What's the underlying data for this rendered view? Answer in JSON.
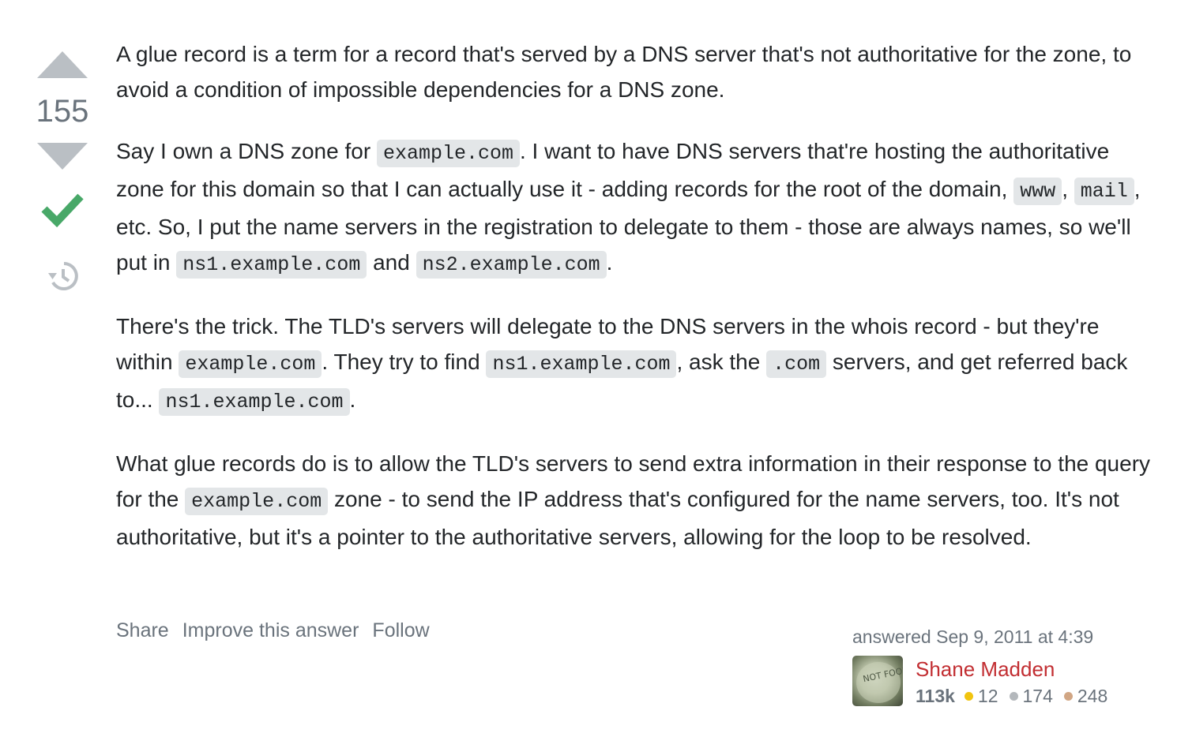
{
  "votes": {
    "count": "155"
  },
  "post": {
    "p1": {
      "t1": "A glue record is a term for a record that's served by a DNS server that's not authoritative for the zone, to avoid a condition of impossible dependencies for a DNS zone."
    },
    "p2": {
      "t1": "Say I own a DNS zone for ",
      "c1": "example.com",
      "t2": ". I want to have DNS servers that're hosting the authoritative zone for this domain so that I can actually use it - adding records for the root of the domain, ",
      "c2": "www",
      "t3": ", ",
      "c3": "mail",
      "t4": ", etc. So, I put the name servers in the registration to delegate to them - those are always names, so we'll put in ",
      "c4": "ns1.example.com",
      "t5": " and ",
      "c5": "ns2.example.com",
      "t6": "."
    },
    "p3": {
      "t1": "There's the trick. The TLD's servers will delegate to the DNS servers in the whois record - but they're within ",
      "c1": "example.com",
      "t2": ". They try to find ",
      "c2": "ns1.example.com",
      "t3": ", ask the ",
      "c3": ".com",
      "t4": " servers, and get referred back to... ",
      "c4": "ns1.example.com",
      "t5": "."
    },
    "p4": {
      "t1": "What glue records do is to allow the TLD's servers to send extra information in their response to the query for the ",
      "c1": "example.com",
      "t2": " zone - to send the IP address that's configured for the name servers, too. It's not authoritative, but it's a pointer to the authoritative servers, allowing for the loop to be resolved."
    }
  },
  "menu": {
    "share": "Share",
    "improve": "Improve this answer",
    "follow": "Follow"
  },
  "user": {
    "action_time": "answered Sep 9, 2011 at 4:39",
    "name": "Shane Madden",
    "reputation": "113k",
    "gold": "12",
    "silver": "174",
    "bronze": "248",
    "avatar_text": "NOT FOOD"
  },
  "colors": {
    "accepted": "#48a868",
    "vote_arrow": "#babfc4",
    "user_link": "#c22e32",
    "gold": "#f1c40f",
    "silver": "#b4b8bc",
    "bronze": "#d1a684"
  }
}
